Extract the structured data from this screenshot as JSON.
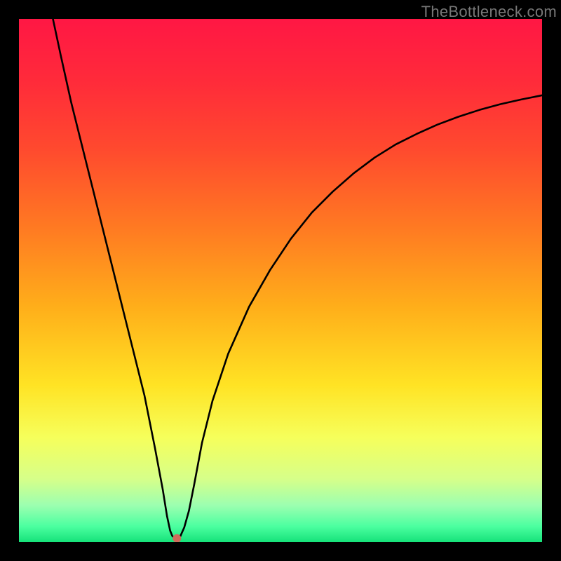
{
  "watermark": "TheBottleneck.com",
  "chart_data": {
    "type": "line",
    "title": "",
    "xlabel": "",
    "ylabel": "",
    "xlim": [
      0,
      100
    ],
    "ylim": [
      0,
      100
    ],
    "grid": false,
    "legend": false,
    "background_gradient_stops": [
      {
        "offset": 0.0,
        "color": "#ff1744"
      },
      {
        "offset": 0.12,
        "color": "#ff2b3a"
      },
      {
        "offset": 0.25,
        "color": "#ff4a2e"
      },
      {
        "offset": 0.4,
        "color": "#ff7a22"
      },
      {
        "offset": 0.55,
        "color": "#ffae1a"
      },
      {
        "offset": 0.7,
        "color": "#ffe324"
      },
      {
        "offset": 0.8,
        "color": "#f6ff5b"
      },
      {
        "offset": 0.88,
        "color": "#d6ff8a"
      },
      {
        "offset": 0.93,
        "color": "#9cffb0"
      },
      {
        "offset": 0.97,
        "color": "#4bffa0"
      },
      {
        "offset": 1.0,
        "color": "#16e27a"
      }
    ],
    "curve": {
      "x": [
        6.5,
        8,
        10,
        12,
        14,
        16,
        18,
        20,
        22,
        24,
        26,
        27.5,
        28.3,
        28.9,
        29.3,
        29.7,
        30.0,
        30.8,
        31.6,
        32.5,
        33.5,
        35,
        37,
        40,
        44,
        48,
        52,
        56,
        60,
        64,
        68,
        72,
        76,
        80,
        84,
        88,
        92,
        96,
        100
      ],
      "y": [
        100,
        93,
        84,
        76,
        68,
        60,
        52,
        44,
        36,
        28,
        18,
        10,
        5,
        2.2,
        1.2,
        0.8,
        0.6,
        1.0,
        2.8,
        6,
        11,
        19,
        27,
        36,
        45,
        52,
        58,
        63,
        67,
        70.5,
        73.5,
        76,
        78,
        79.8,
        81.3,
        82.6,
        83.7,
        84.6,
        85.4
      ]
    },
    "marker": {
      "x": 30.2,
      "y": 0.7,
      "color": "#d06a5a"
    }
  }
}
